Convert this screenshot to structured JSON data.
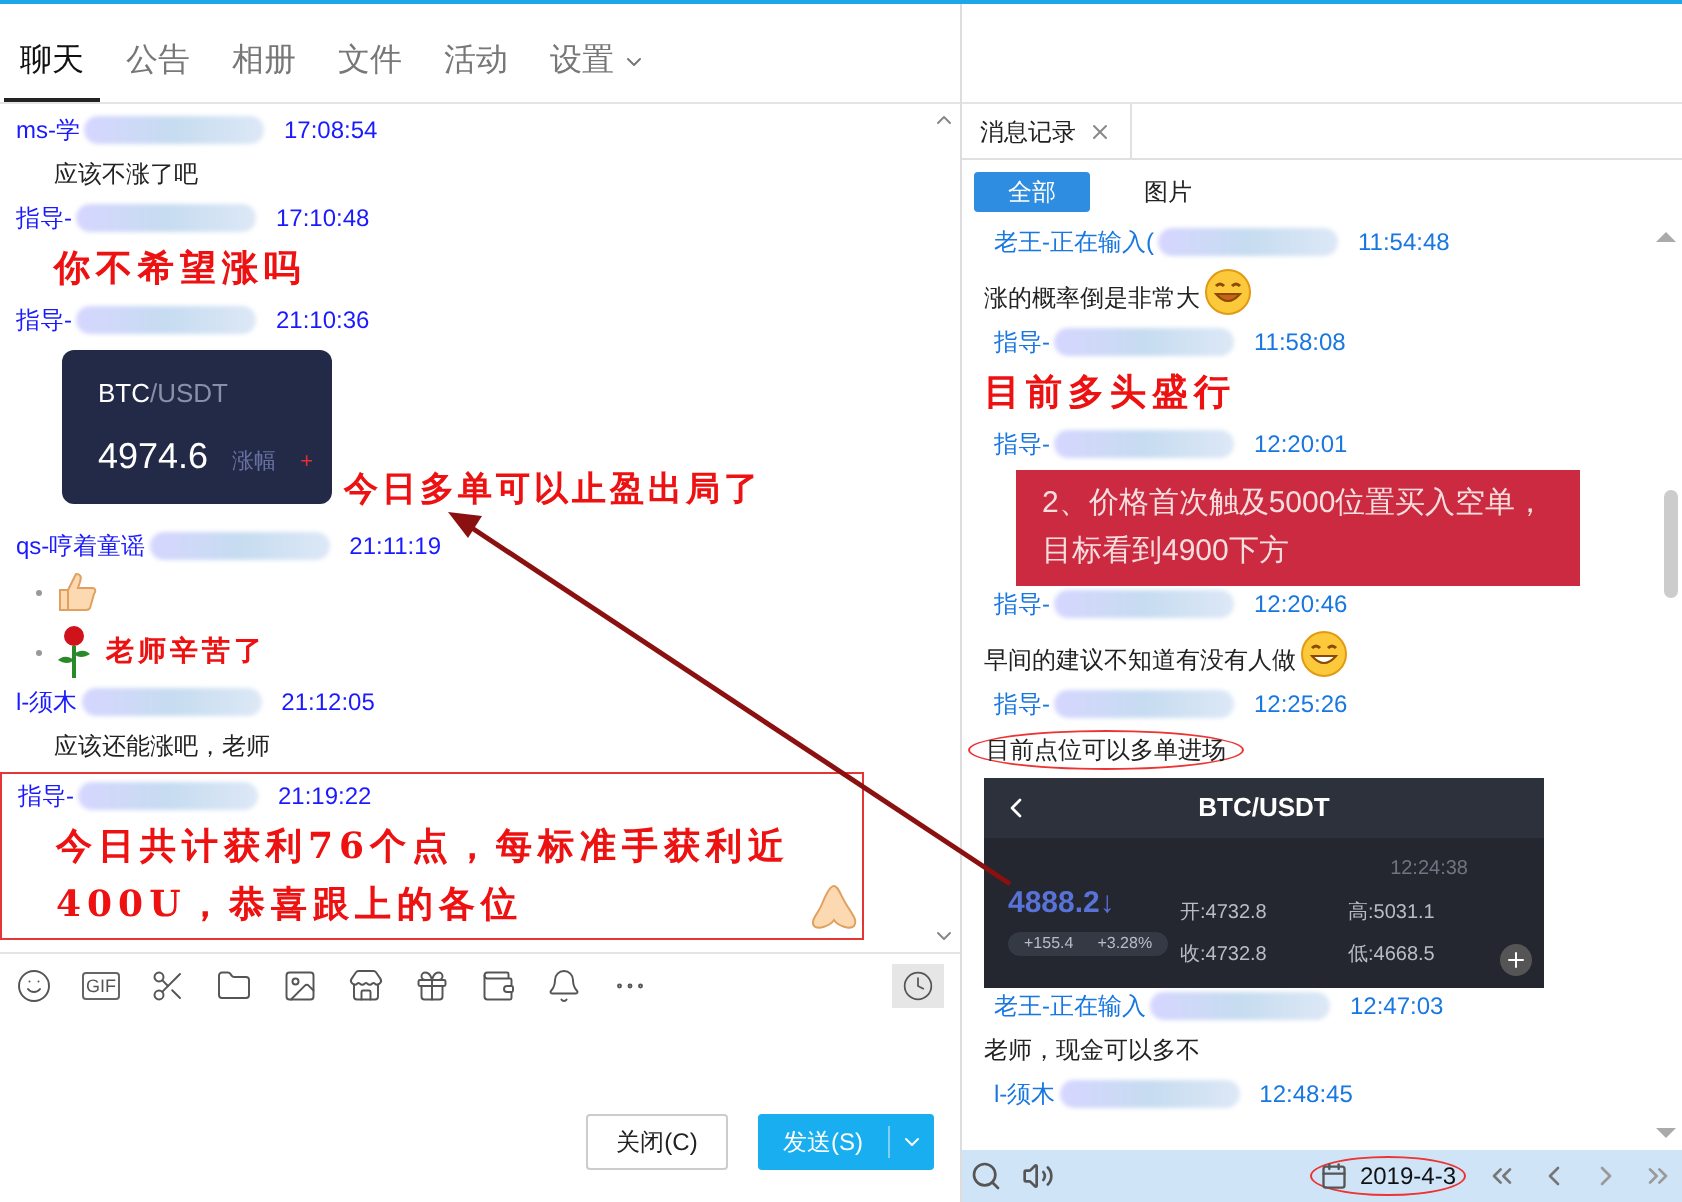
{
  "tabs": [
    {
      "label": "聊天",
      "selected": true,
      "dropdown": false
    },
    {
      "label": "公告",
      "selected": false,
      "dropdown": false
    },
    {
      "label": "相册",
      "selected": false,
      "dropdown": false
    },
    {
      "label": "文件",
      "selected": false,
      "dropdown": false
    },
    {
      "label": "活动",
      "selected": false,
      "dropdown": false
    },
    {
      "label": "设置",
      "selected": false,
      "dropdown": true
    }
  ],
  "chat": {
    "messages": [
      {
        "sender": "ms-学",
        "time": "17:08:54",
        "boxed": false,
        "body": [
          {
            "kind": "text",
            "text": "应该不涨了吧"
          }
        ]
      },
      {
        "sender": "指导-",
        "time": "17:10:48",
        "boxed": false,
        "body": [
          {
            "kind": "red",
            "text": "你不希望涨吗"
          }
        ]
      },
      {
        "sender": "指导-",
        "time": "21:10:36",
        "boxed": false,
        "body": [
          {
            "kind": "ticker",
            "base": "BTC",
            "quote": "/USDT",
            "price": "4974.6",
            "change_label": "涨幅",
            "change": "+"
          }
        ]
      },
      {
        "sender": "qs-哼着童谣",
        "time": "21:11:19",
        "boxed": false,
        "body": [
          {
            "kind": "bullet",
            "emoji": {
              "kind": "thumbs-up"
            }
          },
          {
            "kind": "bullet",
            "emoji": {
              "kind": "rose"
            },
            "text": "老师辛苦了"
          }
        ]
      },
      {
        "sender": "l-须木",
        "time": "21:12:05",
        "boxed": false,
        "body": [
          {
            "kind": "text",
            "text": "应该还能涨吧，老师"
          }
        ]
      },
      {
        "sender": "指导-",
        "time": "21:19:22",
        "boxed": true,
        "body": [
          {
            "kind": "red",
            "text": "今日共计获利76个点，每标准手获利近400U，恭喜跟上的各位",
            "emoji": {
              "kind": "pray"
            }
          }
        ]
      }
    ],
    "annotation": "今日多单可以止盈出局了",
    "toolbar": [
      {
        "kind": "emoji"
      },
      {
        "kind": "gif",
        "label": "GIF"
      },
      {
        "kind": "scissors"
      },
      {
        "kind": "folder"
      },
      {
        "kind": "image"
      },
      {
        "kind": "shop"
      },
      {
        "kind": "gift"
      },
      {
        "kind": "wallet"
      },
      {
        "kind": "bell"
      },
      {
        "kind": "more"
      }
    ],
    "buttons": {
      "close": "关闭(C)",
      "send": "发送(S)"
    }
  },
  "history": {
    "tab": "消息记录",
    "filters": [
      {
        "label": "全部",
        "selected": true
      },
      {
        "label": "图片",
        "selected": false
      }
    ],
    "messages": [
      {
        "sender": "老王-正在输入(",
        "time": "11:54:48",
        "body": [
          {
            "kind": "text",
            "text": "涨的概率倒是非常大",
            "emoji": {
              "kind": "grin-hand"
            }
          }
        ]
      },
      {
        "sender": "指导-",
        "time": "11:58:08",
        "body": [
          {
            "kind": "red",
            "text": "目前多头盛行"
          }
        ]
      },
      {
        "sender": "指导-",
        "time": "12:20:01",
        "body": [
          {
            "kind": "banner",
            "text": "2、价格首次触及5000位置买入空单，目标看到4900下方"
          }
        ]
      },
      {
        "sender": "指导-",
        "time": "12:20:46",
        "body": [
          {
            "kind": "text",
            "text": "早间的建议不知道有没有人做",
            "emoji": {
              "kind": "laugh"
            }
          }
        ]
      },
      {
        "sender": "指导-",
        "time": "12:25:26",
        "body": [
          {
            "kind": "text",
            "text": "目前点位可以多单进场",
            "circled": true
          },
          {
            "kind": "quote-card",
            "title": "BTC/USDT",
            "time": "12:24:38",
            "price": "4888.2↓",
            "change": "+155.4",
            "percent": "+3.28%",
            "open": "开:4732.8",
            "high": "高:5031.1",
            "close": "收:4732.8",
            "low": "低:4668.5"
          }
        ]
      },
      {
        "sender": "老王-正在输入",
        "time": "12:47:03",
        "body": [
          {
            "kind": "text",
            "text": "老师，现金可以多不"
          }
        ]
      },
      {
        "sender": "l-须木",
        "time": "12:48:45"
      }
    ],
    "date": "2019-4-3",
    "date_circled": true
  }
}
